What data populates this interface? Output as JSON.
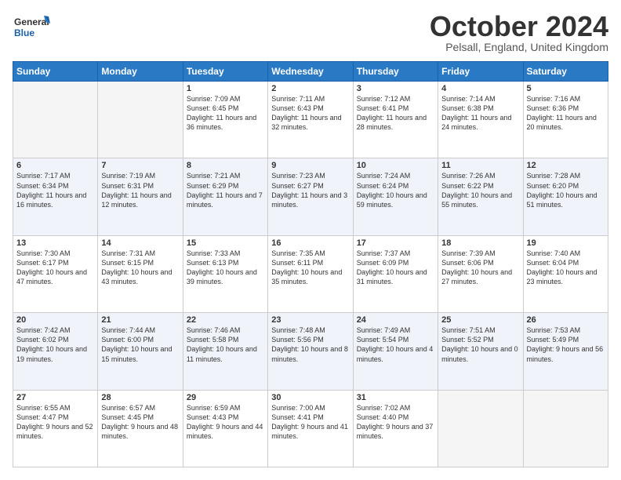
{
  "header": {
    "logo_general": "General",
    "logo_blue": "Blue",
    "month_title": "October 2024",
    "subtitle": "Pelsall, England, United Kingdom"
  },
  "days_of_week": [
    "Sunday",
    "Monday",
    "Tuesday",
    "Wednesday",
    "Thursday",
    "Friday",
    "Saturday"
  ],
  "weeks": [
    [
      {
        "day": "",
        "content": ""
      },
      {
        "day": "",
        "content": ""
      },
      {
        "day": "1",
        "content": "Sunrise: 7:09 AM\nSunset: 6:45 PM\nDaylight: 11 hours and 36 minutes."
      },
      {
        "day": "2",
        "content": "Sunrise: 7:11 AM\nSunset: 6:43 PM\nDaylight: 11 hours and 32 minutes."
      },
      {
        "day": "3",
        "content": "Sunrise: 7:12 AM\nSunset: 6:41 PM\nDaylight: 11 hours and 28 minutes."
      },
      {
        "day": "4",
        "content": "Sunrise: 7:14 AM\nSunset: 6:38 PM\nDaylight: 11 hours and 24 minutes."
      },
      {
        "day": "5",
        "content": "Sunrise: 7:16 AM\nSunset: 6:36 PM\nDaylight: 11 hours and 20 minutes."
      }
    ],
    [
      {
        "day": "6",
        "content": "Sunrise: 7:17 AM\nSunset: 6:34 PM\nDaylight: 11 hours and 16 minutes."
      },
      {
        "day": "7",
        "content": "Sunrise: 7:19 AM\nSunset: 6:31 PM\nDaylight: 11 hours and 12 minutes."
      },
      {
        "day": "8",
        "content": "Sunrise: 7:21 AM\nSunset: 6:29 PM\nDaylight: 11 hours and 7 minutes."
      },
      {
        "day": "9",
        "content": "Sunrise: 7:23 AM\nSunset: 6:27 PM\nDaylight: 11 hours and 3 minutes."
      },
      {
        "day": "10",
        "content": "Sunrise: 7:24 AM\nSunset: 6:24 PM\nDaylight: 10 hours and 59 minutes."
      },
      {
        "day": "11",
        "content": "Sunrise: 7:26 AM\nSunset: 6:22 PM\nDaylight: 10 hours and 55 minutes."
      },
      {
        "day": "12",
        "content": "Sunrise: 7:28 AM\nSunset: 6:20 PM\nDaylight: 10 hours and 51 minutes."
      }
    ],
    [
      {
        "day": "13",
        "content": "Sunrise: 7:30 AM\nSunset: 6:17 PM\nDaylight: 10 hours and 47 minutes."
      },
      {
        "day": "14",
        "content": "Sunrise: 7:31 AM\nSunset: 6:15 PM\nDaylight: 10 hours and 43 minutes."
      },
      {
        "day": "15",
        "content": "Sunrise: 7:33 AM\nSunset: 6:13 PM\nDaylight: 10 hours and 39 minutes."
      },
      {
        "day": "16",
        "content": "Sunrise: 7:35 AM\nSunset: 6:11 PM\nDaylight: 10 hours and 35 minutes."
      },
      {
        "day": "17",
        "content": "Sunrise: 7:37 AM\nSunset: 6:09 PM\nDaylight: 10 hours and 31 minutes."
      },
      {
        "day": "18",
        "content": "Sunrise: 7:39 AM\nSunset: 6:06 PM\nDaylight: 10 hours and 27 minutes."
      },
      {
        "day": "19",
        "content": "Sunrise: 7:40 AM\nSunset: 6:04 PM\nDaylight: 10 hours and 23 minutes."
      }
    ],
    [
      {
        "day": "20",
        "content": "Sunrise: 7:42 AM\nSunset: 6:02 PM\nDaylight: 10 hours and 19 minutes."
      },
      {
        "day": "21",
        "content": "Sunrise: 7:44 AM\nSunset: 6:00 PM\nDaylight: 10 hours and 15 minutes."
      },
      {
        "day": "22",
        "content": "Sunrise: 7:46 AM\nSunset: 5:58 PM\nDaylight: 10 hours and 11 minutes."
      },
      {
        "day": "23",
        "content": "Sunrise: 7:48 AM\nSunset: 5:56 PM\nDaylight: 10 hours and 8 minutes."
      },
      {
        "day": "24",
        "content": "Sunrise: 7:49 AM\nSunset: 5:54 PM\nDaylight: 10 hours and 4 minutes."
      },
      {
        "day": "25",
        "content": "Sunrise: 7:51 AM\nSunset: 5:52 PM\nDaylight: 10 hours and 0 minutes."
      },
      {
        "day": "26",
        "content": "Sunrise: 7:53 AM\nSunset: 5:49 PM\nDaylight: 9 hours and 56 minutes."
      }
    ],
    [
      {
        "day": "27",
        "content": "Sunrise: 6:55 AM\nSunset: 4:47 PM\nDaylight: 9 hours and 52 minutes."
      },
      {
        "day": "28",
        "content": "Sunrise: 6:57 AM\nSunset: 4:45 PM\nDaylight: 9 hours and 48 minutes."
      },
      {
        "day": "29",
        "content": "Sunrise: 6:59 AM\nSunset: 4:43 PM\nDaylight: 9 hours and 44 minutes."
      },
      {
        "day": "30",
        "content": "Sunrise: 7:00 AM\nSunset: 4:41 PM\nDaylight: 9 hours and 41 minutes."
      },
      {
        "day": "31",
        "content": "Sunrise: 7:02 AM\nSunset: 4:40 PM\nDaylight: 9 hours and 37 minutes."
      },
      {
        "day": "",
        "content": ""
      },
      {
        "day": "",
        "content": ""
      }
    ]
  ]
}
